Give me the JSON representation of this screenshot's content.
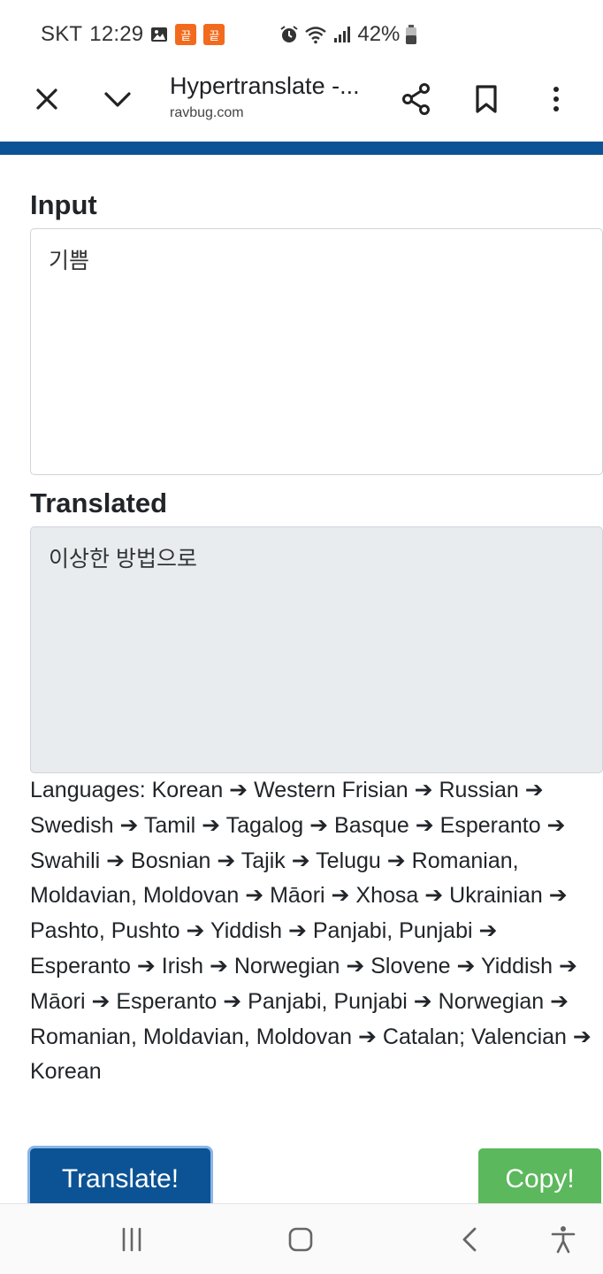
{
  "status_bar": {
    "carrier": "SKT",
    "time": "12:29",
    "notification_badge_1": "끝",
    "notification_badge_2": "끝",
    "battery": "42%"
  },
  "toolbar": {
    "page_title": "Hypertranslate -...",
    "url": "ravbug.com"
  },
  "form": {
    "input_label": "Input",
    "input_value": "기쁨",
    "translated_label": "Translated",
    "translated_value": "이상한 방법으로",
    "languages_text": "Languages: Korean ➔ Western Frisian ➔ Russian ➔ Swedish ➔ Tamil ➔ Tagalog ➔ Basque ➔ Esperanto ➔ Swahili ➔ Bosnian ➔ Tajik ➔ Telugu ➔ Romanian, Moldavian, Moldovan ➔ Māori ➔ Xhosa ➔ Ukrainian ➔ Pashto, Pushto ➔ Yiddish ➔ Panjabi, Punjabi ➔ Esperanto ➔ Irish ➔ Norwegian ➔ Slovene ➔ Yiddish ➔ Māori ➔ Esperanto ➔ Panjabi, Punjabi ➔ Norwegian ➔ Romanian, Moldavian, Moldovan ➔ Catalan; Valencian ➔ Korean",
    "translate_button": "Translate!",
    "copy_button": "Copy!"
  },
  "colors": {
    "brand_blue": "#0b5394",
    "copy_green": "#5cb85c",
    "output_bg": "#e9ecef"
  }
}
